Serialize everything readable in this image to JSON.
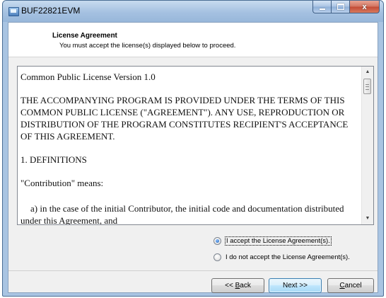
{
  "window": {
    "title": "BUF22821EVM",
    "minimize_glyph": "–",
    "close_glyph": "x"
  },
  "header": {
    "title": "License Agreement",
    "subtitle": "You must accept the license(s) displayed below to proceed."
  },
  "license": {
    "paragraphs": [
      "Common Public License Version 1.0",
      "THE ACCOMPANYING PROGRAM IS PROVIDED UNDER THE TERMS OF THIS COMMON PUBLIC LICENSE (\"AGREEMENT\"). ANY USE, REPRODUCTION OR DISTRIBUTION OF THE PROGRAM CONSTITUTES RECIPIENT'S ACCEPTANCE OF THIS AGREEMENT.",
      "1. DEFINITIONS",
      "\"Contribution\" means:",
      "a) in the case of the initial Contributor, the initial code and documentation distributed under this Agreement, and"
    ]
  },
  "options": {
    "accept": {
      "label": "I accept the License Agreement(s).",
      "selected": true
    },
    "decline": {
      "label": "I do not accept the License Agreement(s).",
      "selected": false
    }
  },
  "buttons": {
    "back_prefix": "<< ",
    "back_mnemonic": "B",
    "back_rest": "ack",
    "next": "Next >>",
    "cancel_mnemonic": "C",
    "cancel_rest": "ancel"
  },
  "scrollbar": {
    "up_glyph": "▲",
    "down_glyph": "▼"
  }
}
